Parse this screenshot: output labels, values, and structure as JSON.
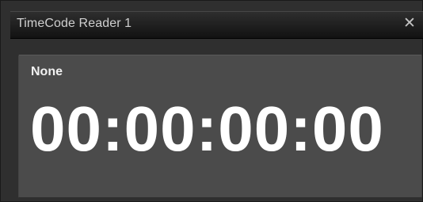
{
  "window": {
    "title": "TimeCode Reader 1",
    "close_icon": "close-icon",
    "close_glyph": "✕"
  },
  "reader": {
    "source": "None",
    "timecode": "00:00:00:00"
  }
}
